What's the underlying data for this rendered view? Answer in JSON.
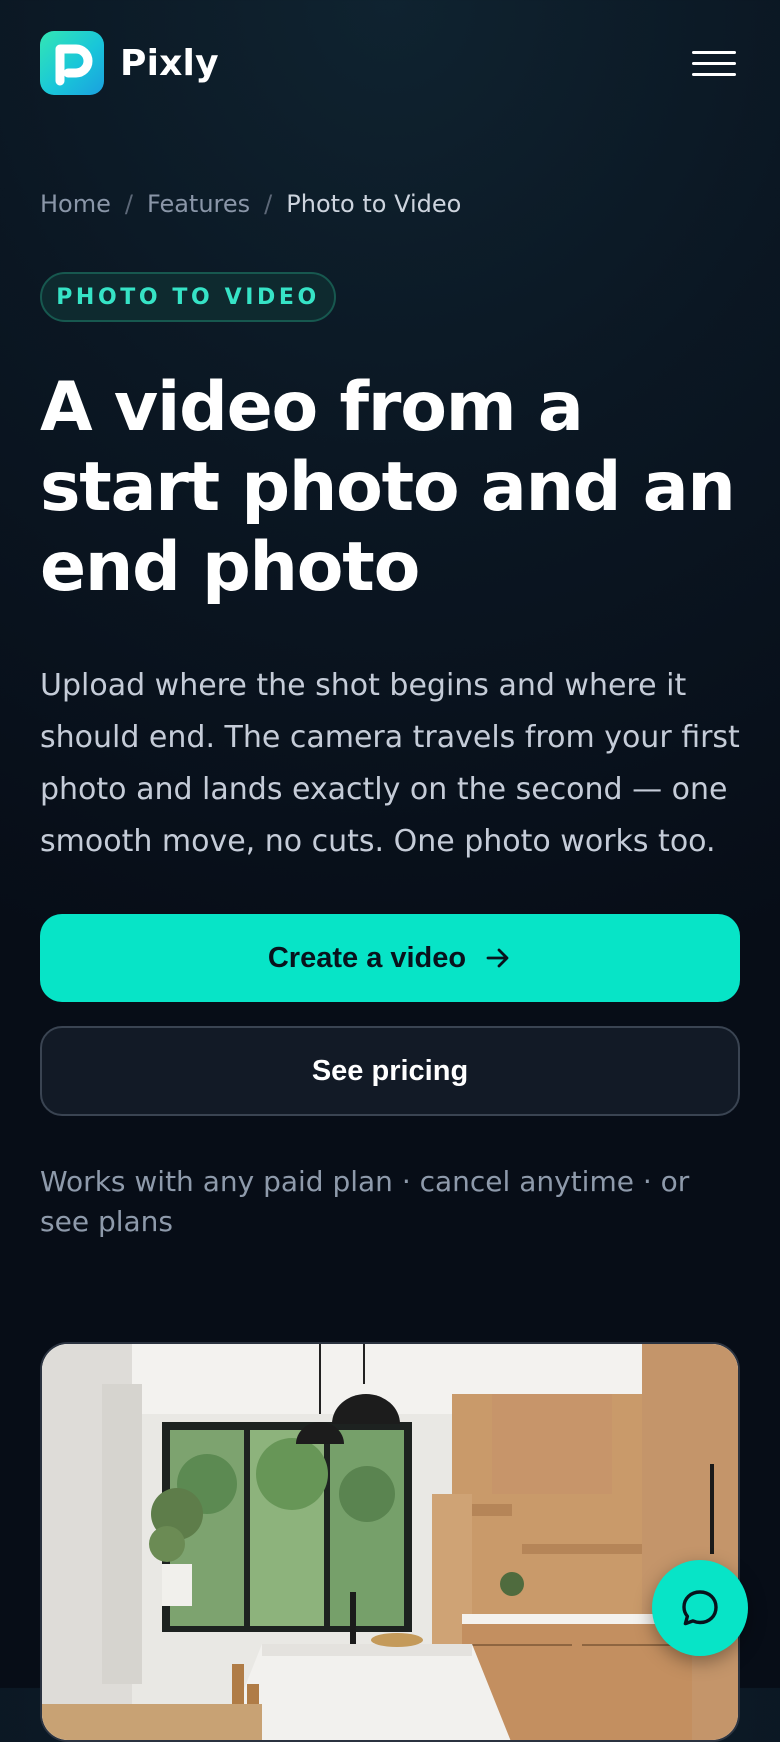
{
  "header": {
    "brand_name": "Pixly",
    "logo_icon": "pixly-logo-icon",
    "menu_icon": "hamburger-menu-icon"
  },
  "breadcrumb": {
    "items": [
      "Home",
      "Features",
      "Photo to Video"
    ],
    "separator": "/"
  },
  "badge": {
    "label": "PHOTO TO VIDEO"
  },
  "hero": {
    "title": "A video from a start photo and an end photo",
    "description": "Upload where the shot begins and where it should end. The camera travels from your first photo and lands exactly on the second — one smooth move, no cuts. One photo works too."
  },
  "actions": {
    "primary_label": "Create a video",
    "primary_icon": "arrow-right-icon",
    "secondary_label": "See pricing"
  },
  "note": "Works with any paid plan · cancel anytime · or see plans",
  "chat": {
    "icon": "chat-bubble-icon"
  },
  "colors": {
    "accent": "#07e4c7",
    "background": "#0b1723",
    "badge_text": "#36e3c6"
  }
}
